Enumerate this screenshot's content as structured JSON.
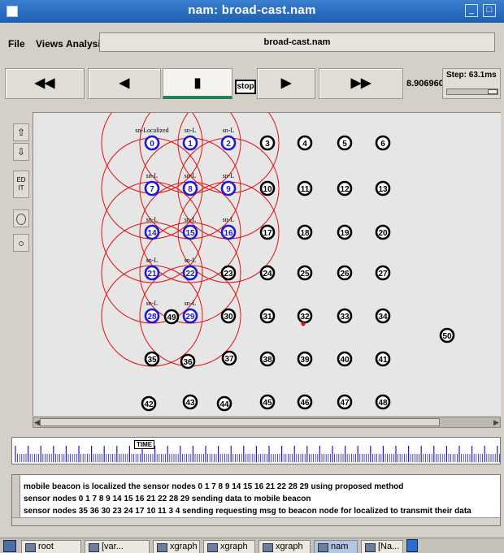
{
  "window": {
    "title": "nam: broad-cast.nam",
    "min_label": "_",
    "max_label": "□"
  },
  "menu": {
    "file": "File",
    "views": "Views",
    "analysis": "Analysis",
    "filename": "broad-cast.nam"
  },
  "controls": {
    "rewind": "◀◀",
    "back": "◀",
    "pause": "▮",
    "stop": "stop",
    "play": "▶",
    "fastforward": "▶▶",
    "time": "8.906960",
    "step": "Step: 63.1ms"
  },
  "tools": {
    "edit": "ED IT"
  },
  "canvas": {
    "nodes": [
      {
        "id": "0",
        "label": "sn-Localized",
        "color": "blue"
      },
      {
        "id": "1",
        "label": "sn-L",
        "color": "blue"
      },
      {
        "id": "2",
        "label": "sn-L",
        "color": "blue"
      },
      {
        "id": "3",
        "label": "",
        "color": "black"
      },
      {
        "id": "4",
        "label": "",
        "color": "black"
      },
      {
        "id": "5",
        "label": "",
        "color": "black"
      },
      {
        "id": "6",
        "label": "",
        "color": "black"
      },
      {
        "id": "7",
        "label": "sn-L",
        "color": "blue"
      },
      {
        "id": "8",
        "label": "sn-L",
        "color": "blue"
      },
      {
        "id": "9",
        "label": "sn-L",
        "color": "blue"
      },
      {
        "id": "10",
        "label": "",
        "color": "black"
      },
      {
        "id": "11",
        "label": "",
        "color": "black"
      },
      {
        "id": "12",
        "label": "",
        "color": "black"
      },
      {
        "id": "13",
        "label": "",
        "color": "black"
      },
      {
        "id": "14",
        "label": "sn-L",
        "color": "blue"
      },
      {
        "id": "15",
        "label": "sn-L",
        "color": "blue"
      },
      {
        "id": "16",
        "label": "sn-L",
        "color": "blue"
      },
      {
        "id": "17",
        "label": "",
        "color": "black"
      },
      {
        "id": "18",
        "label": "",
        "color": "black"
      },
      {
        "id": "19",
        "label": "",
        "color": "black"
      },
      {
        "id": "20",
        "label": "",
        "color": "black"
      },
      {
        "id": "21",
        "label": "sn-L",
        "color": "blue"
      },
      {
        "id": "22",
        "label": "sn-L",
        "color": "blue"
      },
      {
        "id": "23",
        "label": "",
        "color": "black"
      },
      {
        "id": "24",
        "label": "",
        "color": "black"
      },
      {
        "id": "25",
        "label": "",
        "color": "black"
      },
      {
        "id": "26",
        "label": "",
        "color": "black"
      },
      {
        "id": "27",
        "label": "",
        "color": "black"
      },
      {
        "id": "28",
        "label": "sn-L",
        "color": "blue"
      },
      {
        "id": "29",
        "label": "sn-L",
        "color": "blue"
      },
      {
        "id": "30",
        "label": "",
        "color": "black"
      },
      {
        "id": "31",
        "label": "",
        "color": "black"
      },
      {
        "id": "32",
        "label": "",
        "color": "black"
      },
      {
        "id": "33",
        "label": "",
        "color": "black"
      },
      {
        "id": "34",
        "label": "",
        "color": "black"
      },
      {
        "id": "35",
        "label": "",
        "color": "black"
      },
      {
        "id": "36",
        "label": "",
        "color": "black"
      },
      {
        "id": "37",
        "label": "",
        "color": "black"
      },
      {
        "id": "38",
        "label": "",
        "color": "black"
      },
      {
        "id": "39",
        "label": "",
        "color": "black"
      },
      {
        "id": "40",
        "label": "",
        "color": "black"
      },
      {
        "id": "41",
        "label": "",
        "color": "black"
      },
      {
        "id": "42",
        "label": "",
        "color": "black"
      },
      {
        "id": "43",
        "label": "",
        "color": "black"
      },
      {
        "id": "44",
        "label": "",
        "color": "black"
      },
      {
        "id": "45",
        "label": "",
        "color": "black"
      },
      {
        "id": "46",
        "label": "",
        "color": "black"
      },
      {
        "id": "47",
        "label": "",
        "color": "black"
      },
      {
        "id": "48",
        "label": "",
        "color": "black"
      },
      {
        "id": "49",
        "label": "",
        "color": "black"
      },
      {
        "id": "50",
        "label": "",
        "color": "black"
      }
    ],
    "colors": {
      "blue_node": "#1a1ad8",
      "black_node": "#000000",
      "range": "#e01010",
      "background": "#e6e6e6"
    }
  },
  "timeline": {
    "label": "TIME"
  },
  "log": {
    "lines": [
      "mobile beacon is localized the sensor nodes 0 1 7 8 9 14 15 16 21 22 28 29 using proposed method",
      "sensor nodes 0 1 7 8 9 14 15 16 21 22 28 29 sending data to mobile beacon",
      "sensor nodes 35 36 30 23 24 17 10 11 3 4 sending requesting msg to beacon node for localized to transmit their data"
    ]
  },
  "taskbar": {
    "items": [
      "root",
      "[var...",
      "xgraph",
      "xgraph",
      "xgraph",
      "nam",
      "[Na..."
    ]
  }
}
